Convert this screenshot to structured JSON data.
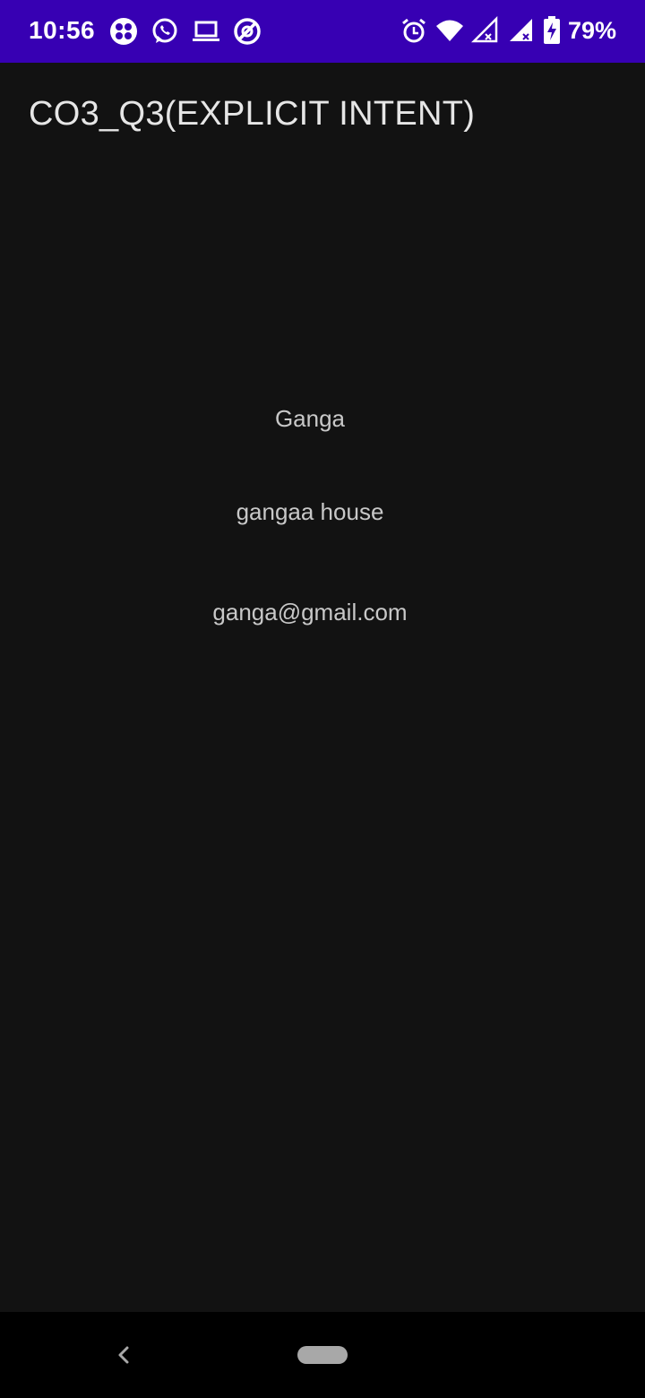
{
  "status_bar": {
    "time": "10:56",
    "battery_percent": "79%",
    "background_color": "#3700B3",
    "left_icons": [
      "app-grid-icon",
      "whatsapp-icon",
      "laptop-icon",
      "no-disturb-icon"
    ],
    "right_icons": [
      "alarm-icon",
      "wifi-icon",
      "signal-icon",
      "signal-icon",
      "battery-charging-icon"
    ]
  },
  "app_bar": {
    "title": "CO3_Q3(EXPLICIT INTENT)"
  },
  "main": {
    "name": "Ganga",
    "address": "gangaa house",
    "email": "ganga@gmail.com"
  },
  "nav_bar": {
    "icons": [
      "back-icon",
      "home-pill-icon"
    ]
  }
}
